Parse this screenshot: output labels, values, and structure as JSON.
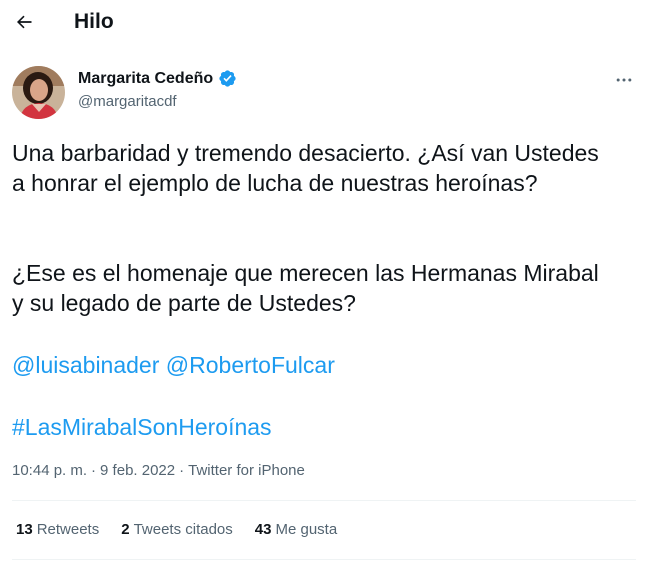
{
  "header": {
    "title": "Hilo",
    "back_icon": "arrow-left-icon"
  },
  "author": {
    "name": "Margarita Cedeño",
    "handle": "@margaritacdf",
    "verified_icon": "verified-badge-icon",
    "verified_color": "#1d9bf0"
  },
  "tweet": {
    "paragraph1": "Una barbaridad y tremendo desacierto. ¿Así van Ustedes a honrar el ejemplo de lucha de nuestras heroínas?",
    "paragraph2": "¿Ese es el homenaje que merecen las Hermanas Mirabal y su legado de parte de Ustedes?",
    "mention1": "@luisabinader",
    "mention2": "@RobertoFulcar",
    "hashtag": "#LasMirabalSonHeroínas",
    "link_color": "#1d9bf0"
  },
  "meta": {
    "time": "10:44 p. m.",
    "separator": "·",
    "date": "9 feb. 2022",
    "source": "Twitter for iPhone"
  },
  "stats": {
    "retweets_count": "13",
    "retweets_label": "Retweets",
    "quotes_count": "2",
    "quotes_label": "Tweets citados",
    "likes_count": "43",
    "likes_label": "Me gusta"
  }
}
